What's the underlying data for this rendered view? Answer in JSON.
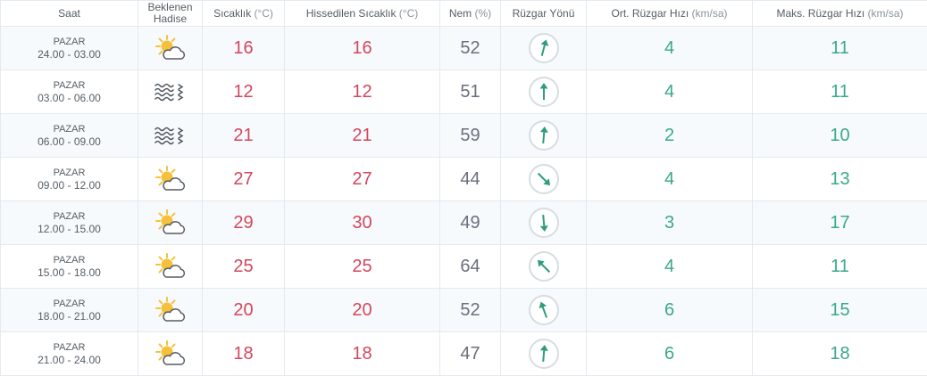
{
  "headers": {
    "saat": "Saat",
    "hadise_line1": "Beklenen",
    "hadise_line2": "Hadise",
    "sicaklik": "Sıcaklık",
    "sicaklik_unit": "(°C)",
    "hissedilen": "Hissedilen Sıcaklık",
    "hissedilen_unit": "(°C)",
    "nem": "Nem",
    "nem_unit": "(%)",
    "ruzgar_yonu": "Rüzgar Yönü",
    "ort_ruzgar": "Ort. Rüzgar Hızı",
    "ort_ruzgar_unit": "(km/sa)",
    "maks_ruzgar": "Maks. Rüzgar Hızı",
    "maks_ruzgar_unit": "(km/sa)"
  },
  "colors": {
    "temperature": "#d2475d",
    "humidity": "#6b6e7e",
    "wind": "#3aa88a",
    "sun": "#f5c13a",
    "arrow": "#2f9c7d"
  },
  "rows": [
    {
      "day": "PAZAR",
      "time": "24.00 - 03.00",
      "icon": "partly-cloudy-icon",
      "temp": "16",
      "feels": "16",
      "humidity": "52",
      "wind_direction_deg": 15,
      "wind_avg": "4",
      "wind_max": "11"
    },
    {
      "day": "PAZAR",
      "time": "03.00 - 06.00",
      "icon": "fog-icon",
      "temp": "12",
      "feels": "12",
      "humidity": "51",
      "wind_direction_deg": 0,
      "wind_avg": "4",
      "wind_max": "11"
    },
    {
      "day": "PAZAR",
      "time": "06.00 - 09.00",
      "icon": "fog-icon",
      "temp": "21",
      "feels": "21",
      "humidity": "59",
      "wind_direction_deg": 5,
      "wind_avg": "2",
      "wind_max": "10"
    },
    {
      "day": "PAZAR",
      "time": "09.00 - 12.00",
      "icon": "partly-cloudy-icon",
      "temp": "27",
      "feels": "27",
      "humidity": "44",
      "wind_direction_deg": 135,
      "wind_avg": "4",
      "wind_max": "13"
    },
    {
      "day": "PAZAR",
      "time": "12.00 - 15.00",
      "icon": "partly-cloudy-icon",
      "temp": "29",
      "feels": "30",
      "humidity": "49",
      "wind_direction_deg": 175,
      "wind_avg": "3",
      "wind_max": "17"
    },
    {
      "day": "PAZAR",
      "time": "15.00 - 18.00",
      "icon": "partly-cloudy-icon",
      "temp": "25",
      "feels": "25",
      "humidity": "64",
      "wind_direction_deg": 315,
      "wind_avg": "4",
      "wind_max": "11"
    },
    {
      "day": "PAZAR",
      "time": "18.00 - 21.00",
      "icon": "partly-cloudy-icon",
      "temp": "20",
      "feels": "20",
      "humidity": "52",
      "wind_direction_deg": 340,
      "wind_avg": "6",
      "wind_max": "15"
    },
    {
      "day": "PAZAR",
      "time": "21.00 - 24.00",
      "icon": "partly-cloudy-icon",
      "temp": "18",
      "feels": "18",
      "humidity": "47",
      "wind_direction_deg": 5,
      "wind_avg": "6",
      "wind_max": "18"
    }
  ]
}
